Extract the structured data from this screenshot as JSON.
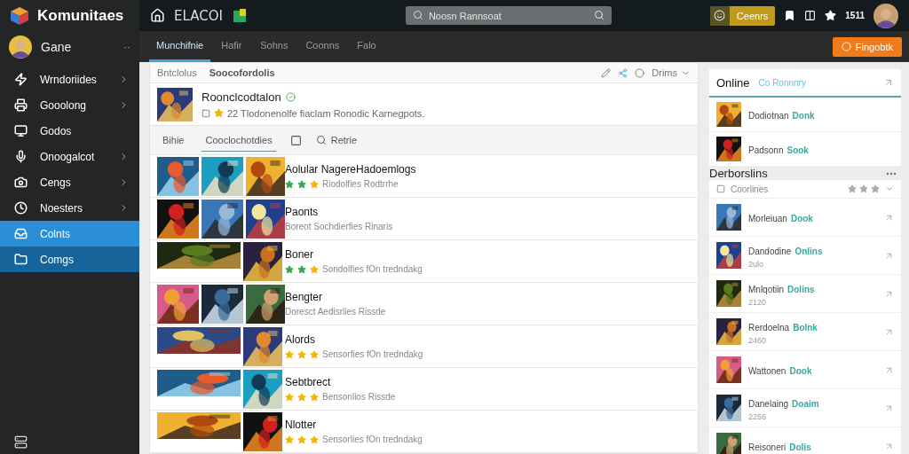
{
  "sidebar": {
    "title": "Komunitaes",
    "user": {
      "name": "Gane",
      "menu": "··"
    },
    "items": [
      {
        "label": "Wrndoriides",
        "arrow": true,
        "selected": false,
        "highlighted": false
      },
      {
        "label": "Gooolong",
        "arrow": true,
        "selected": false,
        "highlighted": false
      },
      {
        "label": "Godos",
        "arrow": false,
        "selected": false,
        "highlighted": false
      },
      {
        "label": "Onoogalcot",
        "arrow": true,
        "selected": false,
        "highlighted": false
      },
      {
        "label": "Cengs",
        "arrow": true,
        "selected": false,
        "highlighted": false
      },
      {
        "label": "Noesters",
        "arrow": true,
        "selected": false,
        "highlighted": false
      },
      {
        "label": "Colnts",
        "arrow": false,
        "selected": true,
        "highlighted": false
      },
      {
        "label": "Comgs",
        "arrow": false,
        "selected": false,
        "highlighted": true
      }
    ]
  },
  "topbar": {
    "brand": "ELACOI",
    "search": {
      "placeholder": "Noosn Rannsoat"
    },
    "badge": "Ceenrs",
    "count": "1511"
  },
  "tabs": [
    {
      "label": "Munchifnie",
      "selected": true
    },
    {
      "label": "Hafir",
      "selected": false
    },
    {
      "label": "Sohns",
      "selected": false
    },
    {
      "label": "Coonns",
      "selected": false
    },
    {
      "label": "Falo",
      "selected": false
    }
  ],
  "action_button": "Fingobtk",
  "main": {
    "strip_tabs": [
      {
        "label": "Bntclolus",
        "selected": false
      },
      {
        "label": "Soocofordolis",
        "selected": true
      }
    ],
    "sort": "Drims",
    "header": {
      "title": "Roonclcodtalon",
      "subtitle": "22 Tlodonenolfe fiaclam Ronodic Karnegpots."
    },
    "subtabs": [
      {
        "label": "Bihie",
        "selected": false
      },
      {
        "label": "Cooclochotdies",
        "selected": true
      }
    ],
    "search_label": "Retrie",
    "games": [
      {
        "title": "Aolular NagereHadoemlogs",
        "subtitle": "Riodolfies Rodtrrhe",
        "thumbnails": [
          {
            "kind": "wide"
          },
          {
            "kind": "wide"
          },
          {
            "kind": "square"
          }
        ],
        "marks": [
          {
            "color": "#35a853"
          },
          {
            "color": "#35a853"
          },
          {
            "color": "#f2b705"
          }
        ]
      },
      {
        "title": "Paonts",
        "subtitle": "Boreot Sochdierfies Rinaris",
        "thumbnails": [
          {
            "kind": "wide"
          },
          {
            "kind": "wide"
          },
          {
            "kind": "square"
          }
        ]
      },
      {
        "title": "Boner",
        "subtitle": "Sondolfies fOn tredndakg",
        "thumbnails": [
          {
            "kind": "banner"
          },
          {
            "kind": "square"
          }
        ],
        "marks": [
          {
            "color": "#35a853"
          },
          {
            "color": "#35a853"
          },
          {
            "color": "#f2b705"
          }
        ]
      },
      {
        "title": "Bengter",
        "subtitle": "Doresct Aedisrlies Rissde",
        "thumbnails": [
          {
            "kind": "wide"
          },
          {
            "kind": "wide"
          },
          {
            "kind": "square"
          }
        ]
      },
      {
        "title": "Alords",
        "subtitle": "Sensorfies fOn tredndakg",
        "thumbnails": [
          {
            "kind": "banner"
          },
          {
            "kind": "square"
          }
        ],
        "marks": [
          {
            "color": "#f2b705"
          },
          {
            "color": "#f2b705"
          },
          {
            "color": "#f2b705"
          }
        ]
      },
      {
        "title": "Sebtbrect",
        "subtitle": "Bensonlios Rissde",
        "thumbnails": [
          {
            "kind": "banner"
          },
          {
            "kind": "square"
          }
        ],
        "marks": [
          {
            "color": "#f2b705"
          },
          {
            "color": "#f2b705"
          },
          {
            "color": "#f2b705"
          }
        ]
      },
      {
        "title": "Nlotter",
        "subtitle": "Sensorlies fOn tredndakg",
        "thumbnails": [
          {
            "kind": "banner"
          },
          {
            "kind": "square"
          }
        ],
        "marks": [
          {
            "color": "#f2b705"
          },
          {
            "color": "#f2b705"
          },
          {
            "color": "#f2b705"
          }
        ]
      }
    ]
  },
  "online": {
    "title": "Online",
    "link": "Co Ronnnry",
    "friends": [
      {
        "name": "Dodiotnan",
        "status": "Donk"
      },
      {
        "name": "Padsonn",
        "status": "Sook"
      }
    ]
  },
  "section": {
    "title": "Derborslins",
    "filter": "Coorlines",
    "friends": [
      {
        "name": "Morleiuan",
        "status": "Dook"
      },
      {
        "name": "Dandodine",
        "status": "Onlins",
        "detail": "2ulo"
      },
      {
        "name": "Mnlqotiin",
        "status": "Dolins",
        "detail": "2120"
      },
      {
        "name": "Rerdoelna",
        "status": "Bolnk",
        "detail": "2460"
      },
      {
        "name": "Wattonen",
        "status": "Dook"
      },
      {
        "name": "Danelaing",
        "status": "Doaim",
        "detail": "2256"
      },
      {
        "name": "Reisoneri",
        "status": "Dolis"
      }
    ]
  }
}
